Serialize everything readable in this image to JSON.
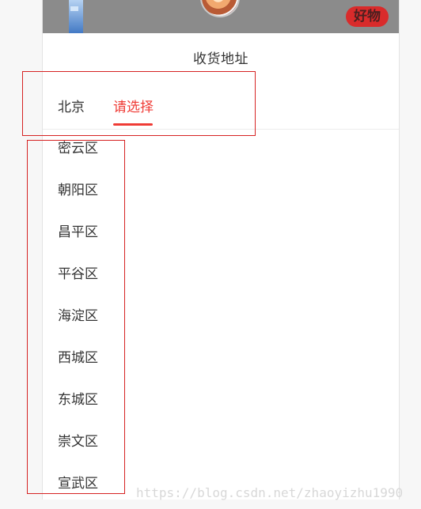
{
  "banner": {
    "button_label": "好物"
  },
  "address_picker": {
    "title": "收货地址",
    "tabs": [
      {
        "label": "北京",
        "state": "selected"
      },
      {
        "label": "请选择",
        "state": "active"
      }
    ],
    "districts": [
      "密云区",
      "朝阳区",
      "昌平区",
      "平谷区",
      "海淀区",
      "西城区",
      "东城区",
      "崇文区",
      "宣武区"
    ]
  },
  "watermark": {
    "text": "https://blog.csdn.net/zhaoyizhu1990"
  },
  "colors": {
    "accent": "#ef3b35",
    "annotation": "#d62323",
    "text": "#333333"
  },
  "icons": {
    "avatar": "avatar"
  }
}
